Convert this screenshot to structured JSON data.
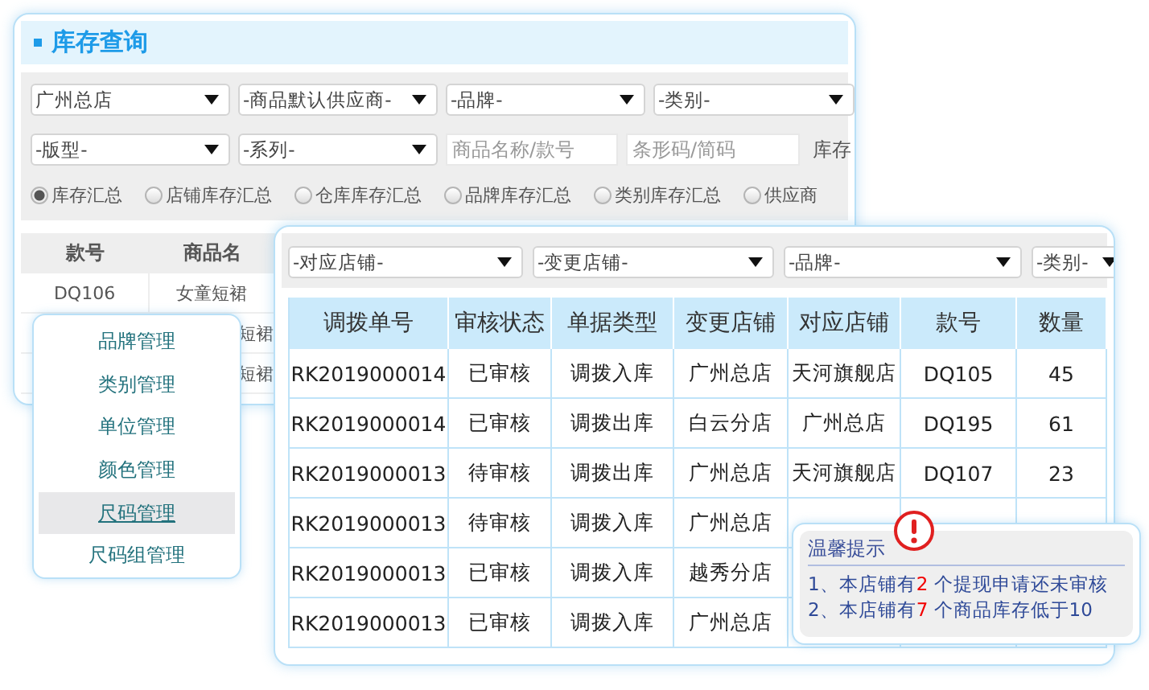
{
  "inventory_window": {
    "title": "库存查询",
    "filters_row_1": [
      {
        "kind": "select",
        "value": "广州总店"
      },
      {
        "kind": "select",
        "value": "-商品默认供应商-"
      },
      {
        "kind": "select",
        "value": "-品牌-"
      },
      {
        "kind": "select",
        "value": "-类别-"
      }
    ],
    "filters_row_2": [
      {
        "kind": "select",
        "value": "-版型-"
      },
      {
        "kind": "select",
        "value": "-系列-"
      },
      {
        "kind": "input",
        "placeholder": "商品名称/款号"
      },
      {
        "kind": "input",
        "placeholder": "条形码/简码"
      },
      {
        "kind": "label",
        "value": "库存"
      }
    ],
    "summary_options": [
      {
        "label": "库存汇总",
        "selected": true
      },
      {
        "label": "店铺库存汇总",
        "selected": false
      },
      {
        "label": "仓库库存汇总",
        "selected": false
      },
      {
        "label": "品牌库存汇总",
        "selected": false
      },
      {
        "label": "类别库存汇总",
        "selected": false
      },
      {
        "label": "供应商",
        "selected": false
      }
    ],
    "table": {
      "columns": [
        "款号",
        "商品名"
      ],
      "rows": [
        [
          "DQ106",
          "女童短裙"
        ],
        [
          "",
          "短裙"
        ],
        [
          "",
          "短裙"
        ]
      ]
    }
  },
  "settings_menu": {
    "items": [
      {
        "label": "品牌管理",
        "selected": false
      },
      {
        "label": "类别管理",
        "selected": false
      },
      {
        "label": "单位管理",
        "selected": false
      },
      {
        "label": "颜色管理",
        "selected": false
      },
      {
        "label": "尺码管理",
        "selected": true
      },
      {
        "label": "尺码组管理",
        "selected": false
      }
    ]
  },
  "transfer_window": {
    "filters": [
      "-对应店铺-",
      "-变更店铺-",
      "-品牌-",
      "-类别-"
    ],
    "table": {
      "columns": [
        "调拨单号",
        "审核状态",
        "单据类型",
        "变更店铺",
        "对应店铺",
        "款号",
        "数量"
      ],
      "rows": [
        [
          "RK2019000014",
          "已审核",
          "调拨入库",
          "广州总店",
          "天河旗舰店",
          "DQ105",
          "45"
        ],
        [
          "RK2019000014",
          "已审核",
          "调拨出库",
          "白云分店",
          "广州总店",
          "DQ195",
          "61"
        ],
        [
          "RK2019000013",
          "待审核",
          "调拨出库",
          "广州总店",
          "天河旗舰店",
          "DQ107",
          "23"
        ],
        [
          "RK2019000013",
          "待审核",
          "调拨入库",
          "广州总店"
        ],
        [
          "RK2019000013",
          "已审核",
          "调拨入库",
          "越秀分店"
        ],
        [
          "RK2019000013",
          "已审核",
          "调拨入库",
          "广州总店"
        ]
      ]
    }
  },
  "notice": {
    "title": "温馨提示",
    "lines": [
      {
        "prefix": "1、本店铺有",
        "count": "2",
        "suffix": " 个提现申请还未审核"
      },
      {
        "prefix": "2、本店铺有",
        "count": "7",
        "suffix": " 个商品库存低于10"
      }
    ]
  }
}
